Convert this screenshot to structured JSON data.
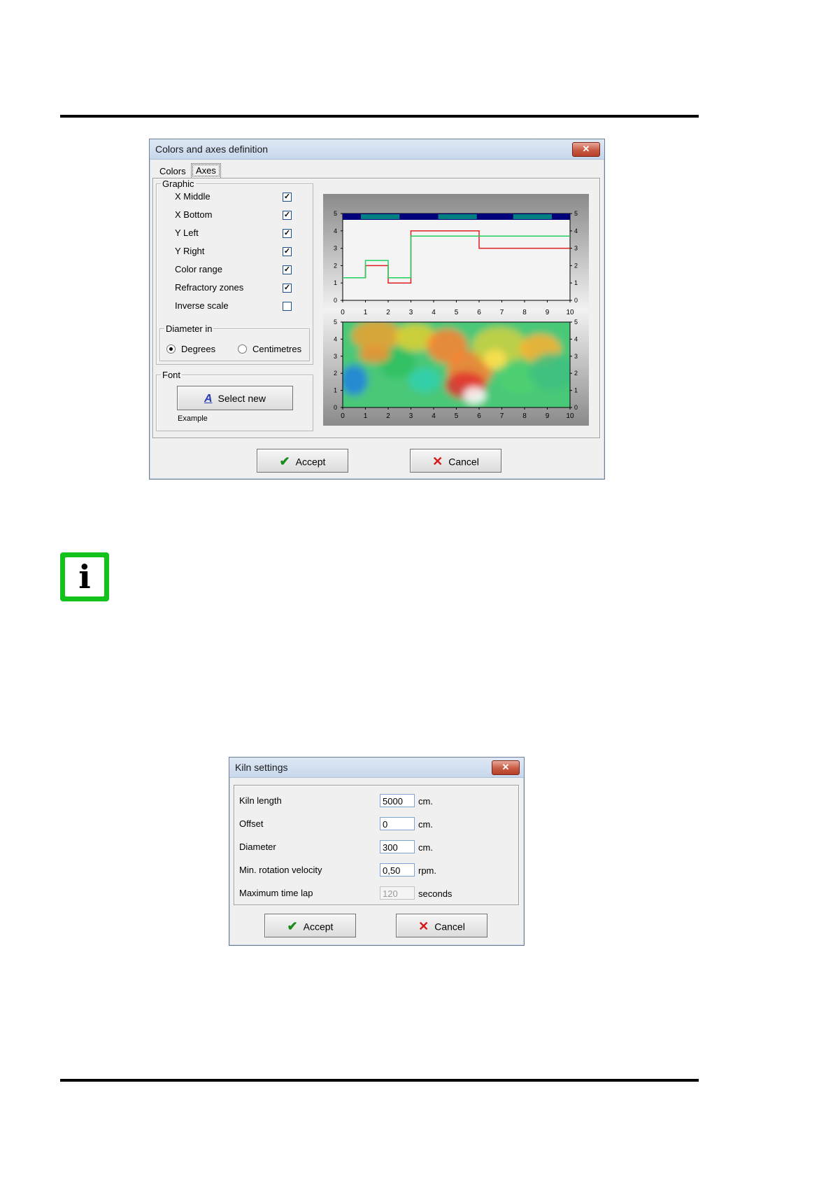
{
  "dialog1": {
    "title": "Colors and axes definition",
    "close": "✕",
    "tabs": [
      "Colors",
      "Axes"
    ],
    "graphic": {
      "legend": "Graphic",
      "options": [
        {
          "label": "X Middle",
          "checked": true
        },
        {
          "label": "X Bottom",
          "checked": true
        },
        {
          "label": "Y Left",
          "checked": true
        },
        {
          "label": "Y Right",
          "checked": true
        },
        {
          "label": "Color range",
          "checked": true
        },
        {
          "label": "Refractory zones",
          "checked": true
        },
        {
          "label": "Inverse scale",
          "checked": false
        }
      ]
    },
    "diameter": {
      "legend": "Diameter in",
      "options": [
        {
          "label": "Degrees",
          "selected": true
        },
        {
          "label": "Centimetres",
          "selected": false
        }
      ]
    },
    "font": {
      "legend": "Font",
      "button": "Select new",
      "button_icon": "A",
      "example": "Example"
    },
    "accept": "Accept",
    "cancel": "Cancel"
  },
  "dialog2": {
    "title": "Kiln settings",
    "close": "✕",
    "fields": [
      {
        "label": "Kiln length",
        "value": "5000",
        "unit": "cm.",
        "disabled": false
      },
      {
        "label": "Offset",
        "value": "0",
        "unit": "cm.",
        "disabled": false
      },
      {
        "label": "Diameter",
        "value": "300",
        "unit": "cm.",
        "disabled": false
      },
      {
        "label": "Min. rotation velocity",
        "value": "0,50",
        "unit": "rpm.",
        "disabled": false
      },
      {
        "label": "Maximum time lap",
        "value": "120",
        "unit": "seconds",
        "disabled": true
      }
    ],
    "accept": "Accept",
    "cancel": "Cancel"
  },
  "info_icon": {
    "glyph": "i",
    "color": "#13c21b"
  },
  "chart_data": [
    {
      "type": "line",
      "x_ticks": [
        "0",
        "1",
        "2",
        "3",
        "4",
        "5",
        "6",
        "7",
        "8",
        "9",
        "10"
      ],
      "y_ticks": [
        "0",
        "1",
        "2",
        "3",
        "4",
        "5"
      ],
      "xlim": [
        0,
        10
      ],
      "ylim": [
        0,
        5
      ],
      "grid": false,
      "series": [
        {
          "color": "#e02020",
          "x": [
            0,
            1,
            1,
            2,
            2,
            3,
            3,
            6,
            6,
            10
          ],
          "y": [
            1.3,
            1.3,
            2,
            2,
            1,
            1,
            4,
            4,
            3,
            3
          ]
        },
        {
          "color": "#20d060",
          "x": [
            0,
            1,
            1,
            2,
            2,
            3,
            3,
            10
          ],
          "y": [
            1.3,
            1.3,
            2.3,
            2.3,
            1.3,
            1.3,
            3.7,
            3.7
          ]
        }
      ],
      "zones": [
        {
          "color": "#008080",
          "x": [
            0.8,
            2.5
          ]
        },
        {
          "color": "#008080",
          "x": [
            4.2,
            5.9
          ]
        },
        {
          "color": "#008080",
          "x": [
            7.5,
            9.2
          ]
        }
      ],
      "zone_band_color": "#00007a"
    },
    {
      "type": "heatmap",
      "x_ticks": [
        "0",
        "1",
        "2",
        "3",
        "4",
        "5",
        "6",
        "7",
        "8",
        "9",
        "10"
      ],
      "y_ticks": [
        "0",
        "1",
        "2",
        "3",
        "4",
        "5"
      ],
      "xlim": [
        0,
        10
      ],
      "ylim": [
        0,
        5
      ],
      "colorscale": [
        "#1010a0",
        "#2090ff",
        "#20d0d0",
        "#40d040",
        "#e0e020",
        "#ff8020",
        "#e02020",
        "#ffffff"
      ]
    }
  ]
}
